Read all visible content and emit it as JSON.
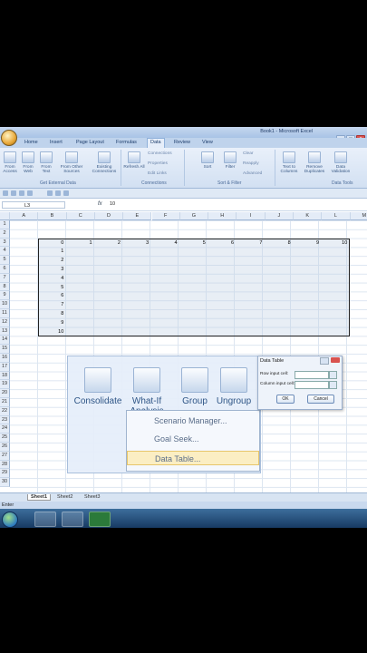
{
  "window": {
    "title": "Book1 - Microsoft Excel"
  },
  "tabs": [
    "Home",
    "Insert",
    "Page Layout",
    "Formulas",
    "Data",
    "Review",
    "View"
  ],
  "ribbon": {
    "buttons": [
      "From Access",
      "From Web",
      "From Text",
      "From Other Sources",
      "Existing Connections",
      "Refresh All",
      "Sort",
      "Filter",
      "Text to Columns",
      "Remove Duplicates",
      "Data Validation"
    ],
    "small": [
      "Connections",
      "Properties",
      "Edit Links",
      "Clear",
      "Reapply",
      "Advanced"
    ],
    "groups": [
      "Get External Data",
      "Connections",
      "Sort & Filter",
      "Data Tools"
    ]
  },
  "formula_bar": {
    "name_box": "L3",
    "fx": "fx",
    "value": "10"
  },
  "columns": [
    "A",
    "B",
    "C",
    "D",
    "E",
    "F",
    "G",
    "H",
    "I",
    "J",
    "K",
    "L",
    "M"
  ],
  "rows": [
    "1",
    "2",
    "3",
    "4",
    "5",
    "6",
    "7",
    "8",
    "9",
    "10",
    "11",
    "12",
    "13",
    "14",
    "15",
    "16",
    "17",
    "18",
    "19",
    "20",
    "21",
    "22",
    "23",
    "24",
    "25",
    "26",
    "27",
    "28",
    "29",
    "30"
  ],
  "row3_values": [
    "0",
    "1",
    "2",
    "3",
    "4",
    "5",
    "6",
    "7",
    "8",
    "9",
    "10"
  ],
  "colB_values": [
    "1",
    "2",
    "3",
    "4",
    "5",
    "6",
    "7",
    "8",
    "9",
    "10"
  ],
  "zoom_overlay": {
    "buttons": [
      "Consolidate",
      "What-If Analysis",
      "Group",
      "Ungroup"
    ],
    "menu": [
      "Scenario Manager...",
      "Goal Seek...",
      "Data Table..."
    ]
  },
  "dialog": {
    "title": "Data Table",
    "row_label": "Row input cell:",
    "col_label": "Column input cell:",
    "ok": "OK",
    "cancel": "Cancel"
  },
  "sheets": [
    "Sheet1",
    "Sheet2",
    "Sheet3"
  ],
  "status": "Enter"
}
